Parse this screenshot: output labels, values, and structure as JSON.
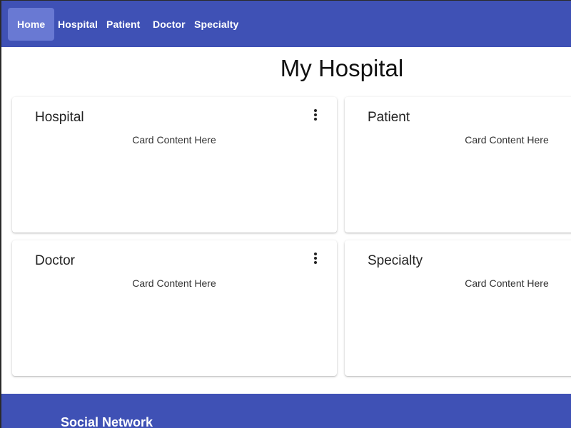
{
  "nav": {
    "items": [
      {
        "label": "Home",
        "active": true
      },
      {
        "label": "Hospital",
        "active": false
      },
      {
        "label": "Patient",
        "active": false
      },
      {
        "label": "Doctor",
        "active": false
      },
      {
        "label": "Specialty",
        "active": false
      }
    ]
  },
  "page_title": "My Hospital",
  "cards": [
    {
      "title": "Hospital",
      "content": "Card Content Here",
      "menu_icon": "more-vert-icon"
    },
    {
      "title": "Patient",
      "content": "Card Content Here"
    },
    {
      "title": "Doctor",
      "content": "Card Content Here",
      "menu_icon": "more-vert-icon"
    },
    {
      "title": "Specialty",
      "content": "Card Content Here"
    }
  ],
  "footer": {
    "heading": "Social Network"
  },
  "colors": {
    "primary": "#3f51b5",
    "nav_active": "#6979d3"
  }
}
